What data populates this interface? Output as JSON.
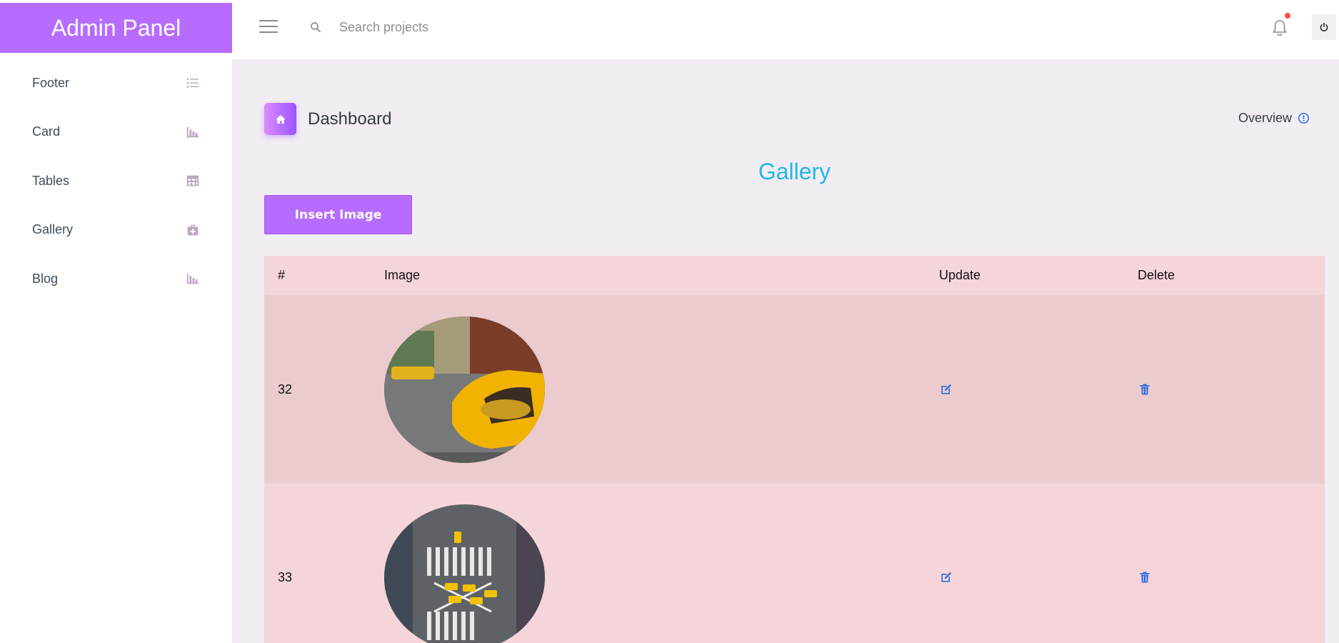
{
  "brand": {
    "title": "Admin Panel"
  },
  "sidebar": {
    "items": [
      {
        "label": "Footer",
        "icon": "list-icon"
      },
      {
        "label": "Card",
        "icon": "bar-chart-icon"
      },
      {
        "label": "Tables",
        "icon": "table-icon"
      },
      {
        "label": "Gallery",
        "icon": "medical-bag-icon"
      },
      {
        "label": "Blog",
        "icon": "bar-chart-icon"
      }
    ]
  },
  "topbar": {
    "search_placeholder": "Search projects",
    "icons": [
      "menu-icon",
      "search-icon",
      "bell-icon",
      "power-icon"
    ]
  },
  "header": {
    "title": "Dashboard",
    "overview": "Overview"
  },
  "gallery": {
    "title": "Gallery",
    "insert_label": "Insert Image",
    "columns": [
      "#",
      "Image",
      "Update",
      "Delete"
    ],
    "rows": [
      {
        "id": "32",
        "image": "yellow taxi on city street"
      },
      {
        "id": "33",
        "image": "aerial view of crosswalk with taxis"
      }
    ]
  },
  "colors": {
    "brand": "#b66dff",
    "accent_title": "#1fb8e6",
    "row_odd": "#eccbce",
    "row_even": "#f5d5da",
    "action_icon": "#2f6fe0",
    "notification_dot": "#fe4a4a"
  }
}
